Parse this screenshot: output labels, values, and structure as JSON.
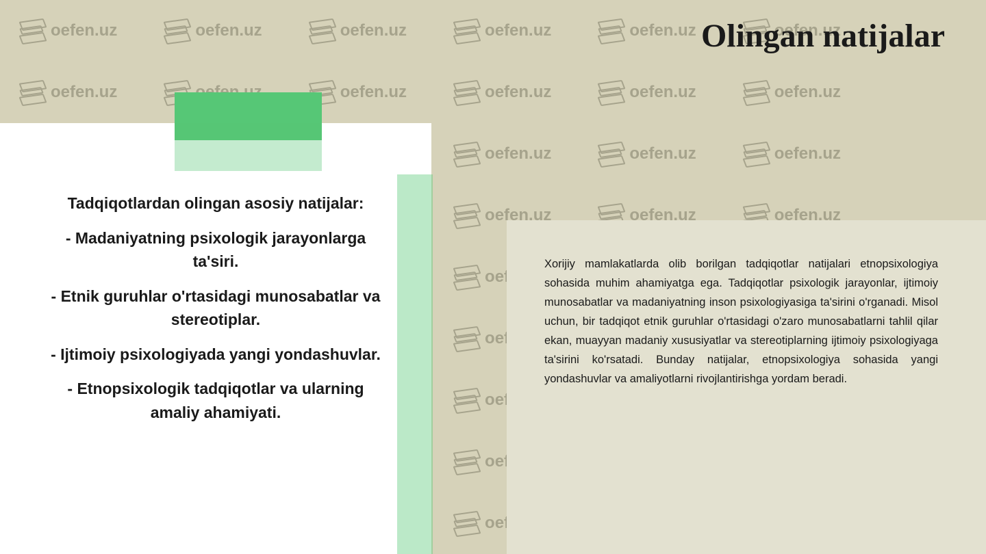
{
  "title": "Olingan natijalar",
  "watermark": "oefen.uz",
  "left_card": {
    "heading": "Tadqiqotlardan olingan asosiy natijalar:",
    "items": [
      "- Madaniyatning psixologik jarayonlarga ta'siri.",
      "- Etnik guruhlar o'rtasidagi munosabatlar va stereotiplar.",
      "- Ijtimoiy psixologiyada yangi yondashuvlar.",
      "- Etnopsixologik tadqiqotlar va ularning amaliy ahamiyati."
    ]
  },
  "right_card": {
    "body": "Xorijiy mamlakatlarda olib borilgan tadqiqotlar natijalari etnopsixologiya sohasida muhim ahamiyatga ega. Tadqiqotlar psixologik jarayonlar, ijtimoiy munosabatlar va madaniyatning inson psixologiyasiga ta'sirini o'rganadi. Misol uchun, bir tadqiqot etnik guruhlar o'rtasidagi o'zaro munosabatlarni tahlil qilar ekan, muayyan madaniy xususiyatlar va stereotiplarning ijtimoiy psixologiyaga ta'sirini ko'rsatadi. Bunday natijalar, etnopsixologiya sohasida yangi yondashuvlar va amaliyotlarni rivojlantirishga yordam beradi."
  }
}
